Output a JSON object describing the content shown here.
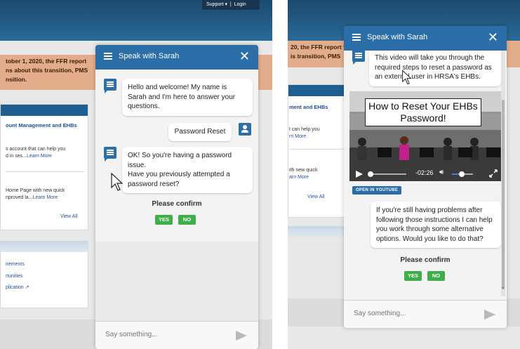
{
  "left_page": {
    "support_label": "Support ▾",
    "login_label": "Login",
    "notice_lines": [
      "tober 1, 2020, the FFR report",
      "ns about this transition, PMS",
      "nsition."
    ],
    "card_title": "ount Management and EHBs",
    "item1_text": "s account that can help you",
    "item1_text2": "d in ses...",
    "item1_link": "Learn More",
    "item2_text": "Home Page with new quick",
    "item2_text2": "nproved la...",
    "item2_link": "Learn More",
    "view_all": "View All",
    "links": [
      "irements",
      "rtunities",
      "plication ↗"
    ]
  },
  "right_page": {
    "notice_lines": [
      "20, the FFR report v",
      "is transition, PMS"
    ],
    "card_title": "ment and EHBs",
    "item1_text": "t can help you",
    "item1_link": "rn More",
    "item2_text": "ith new quick",
    "item2_link": "arn More",
    "view_all": "View All"
  },
  "chat_left": {
    "title": "Speak with Sarah",
    "msg1": "Hello and welcome! My name is Sarah and I'm here to answer your questions.",
    "user_msg": "Password Reset",
    "msg2_line1": "OK! So you're having a password issue.",
    "msg2_line2": "Have you previously attempted a password reset?",
    "confirm_label": "Please confirm",
    "yes_label": "YES",
    "no_label": "NO",
    "input_placeholder": "Say something..."
  },
  "chat_right": {
    "title": "Speak with Sarah",
    "msg_top": "This video will take you through the required steps to reset a password as an external user in HRSA's EHBs.",
    "video_title": "How to Reset Your EHBs Password!",
    "video_time": "-02:26",
    "youtube_label": "OPEN IN YOUTUBE",
    "msg_bottom": "If you're still having problems after following those instructions I can help you work through some alternative options. Would you like to do that?",
    "confirm_label": "Please confirm",
    "yes_label": "YES",
    "no_label": "NO",
    "input_placeholder": "Say something..."
  },
  "colors": {
    "header_blue": "#2c6ea8",
    "confirm_green": "#3fae49",
    "notice_orange": "#e3ad8c"
  }
}
